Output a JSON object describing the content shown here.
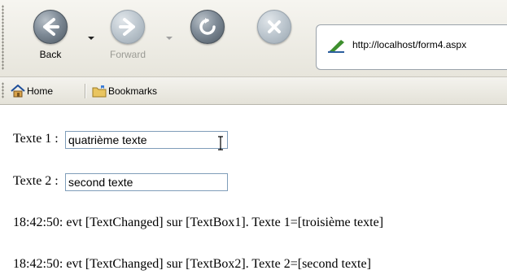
{
  "toolbar": {
    "back_label": "Back",
    "forward_label": "Forward",
    "address_url": "http://localhost/form4.aspx"
  },
  "links": {
    "home_label": "Home",
    "bookmarks_label": "Bookmarks"
  },
  "form": {
    "label1": "Texte 1 :",
    "value1": "quatrième texte",
    "label2": "Texte 2 :",
    "value2": "second texte"
  },
  "log": [
    "18:42:50: evt [TextChanged] sur [TextBox1]. Texte 1=[troisième texte]",
    "18:42:50: evt [TextChanged] sur [TextBox2]. Texte 2=[second texte]"
  ],
  "icons": {
    "back": "back-arrow-icon",
    "forward": "forward-arrow-icon",
    "reload": "reload-icon",
    "stop": "stop-icon",
    "page": "page-icon",
    "home": "home-icon",
    "bookmarks": "bookmarks-folder-icon"
  },
  "colors": {
    "textbox_border": "#7f9db9",
    "toolbar_bg": "#ecebe5"
  }
}
